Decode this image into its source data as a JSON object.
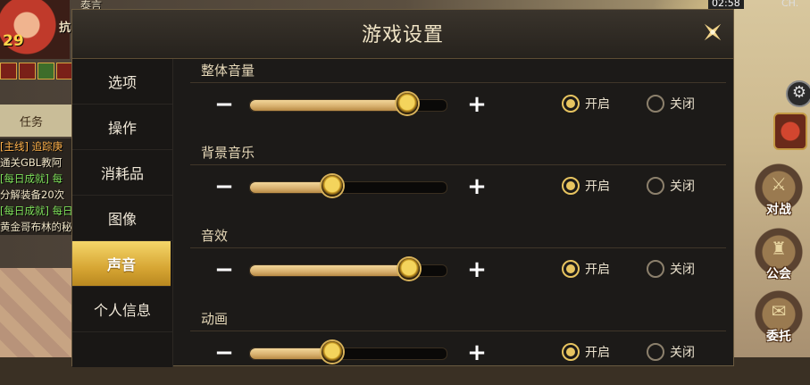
{
  "background": {
    "player_level": "29",
    "player_name_top": "泰言",
    "player_name_side": "抗",
    "task_tab_label": "任务",
    "quests": [
      {
        "text": "[主线] 追踪庚",
        "style": "t o"
      },
      {
        "text": "通关GBL教阿",
        "style": "d"
      },
      {
        "text": "[每日成就] 每",
        "style": "t"
      },
      {
        "text": "分解装备20次",
        "style": "d"
      },
      {
        "text": "[每日成就] 每日",
        "style": "t"
      },
      {
        "text": "黄金哥布林的秘",
        "style": "d"
      }
    ],
    "clock": "02:58",
    "clock_right": "CH.",
    "side_buttons": [
      {
        "label": "对战",
        "icon": "⚔"
      },
      {
        "label": "公会",
        "icon": "♜"
      },
      {
        "label": "委托",
        "icon": "✉"
      }
    ]
  },
  "dialog": {
    "title": "游戏设置",
    "sidebar": [
      {
        "label": "选项",
        "active": false
      },
      {
        "label": "操作",
        "active": false
      },
      {
        "label": "消耗品",
        "active": false
      },
      {
        "label": "图像",
        "active": false
      },
      {
        "label": "声音",
        "active": true
      },
      {
        "label": "个人信息",
        "active": false
      }
    ],
    "minus_symbol": "−",
    "plus_symbol": "+",
    "on_label": "开启",
    "off_label": "关闭",
    "sections": [
      {
        "title": "整体音量",
        "level_percent": 80,
        "enabled": true
      },
      {
        "title": "背景音乐",
        "level_percent": 42,
        "enabled": true
      },
      {
        "title": "音效",
        "level_percent": 81,
        "enabled": true
      },
      {
        "title": "动画",
        "level_percent": 42,
        "enabled": true
      }
    ]
  }
}
